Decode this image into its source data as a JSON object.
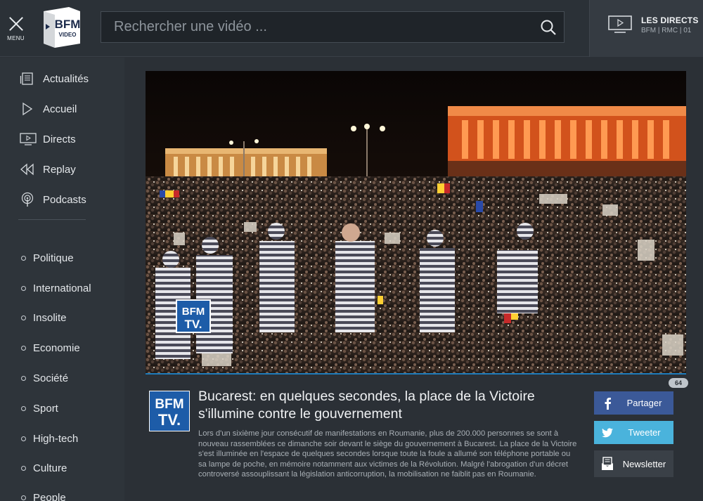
{
  "header": {
    "menu_label": "MENU",
    "logo_text_top": "BFM",
    "logo_text_bottom": "VIDEO",
    "search_placeholder": "Rechercher une vidéo ...",
    "directs_title": "LES DIRECTS",
    "directs_sub": "BFM | RMC | 01"
  },
  "sidebar": {
    "nav": [
      {
        "label": "Actualités",
        "icon": "newspaper-icon"
      },
      {
        "label": "Accueil",
        "icon": "play-outline-icon"
      },
      {
        "label": "Directs",
        "icon": "tv-icon"
      },
      {
        "label": "Replay",
        "icon": "rewind-icon"
      },
      {
        "label": "Podcasts",
        "icon": "podcast-icon"
      }
    ],
    "categories": [
      "Politique",
      "International",
      "Insolite",
      "Economie",
      "Société",
      "Sport",
      "High-tech",
      "Culture",
      "People"
    ]
  },
  "video": {
    "channel_watermark_top": "BFM",
    "channel_watermark_bottom": "TV."
  },
  "article": {
    "views": "64",
    "logo_top": "BFM",
    "logo_bottom": "TV.",
    "title": "Bucarest: en quelques secondes, la place de la Victoire s'illumine contre le gouvernement",
    "description": "Lors d'un sixième jour consécutif de manifestations en Roumanie, plus de 200.000 personnes se sont à nouveau rassemblées ce dimanche soir devant le siège du gouvernement à Bucarest. La place de la Victoire s'est illuminée en l'espace de quelques secondes lorsque toute la foule a allumé son téléphone portable ou sa lampe de poche, en mémoire notamment aux victimes de la Révolution. Malgré l'abrogation d'un décret controversé assouplissant la législation anticorruption, la mobilisation ne faiblit pas en Roumanie."
  },
  "share": {
    "facebook": "Partager",
    "twitter": "Tweeter",
    "newsletter": "Newsletter"
  },
  "colors": {
    "background": "#2b3036",
    "facebook": "#3b5998",
    "twitter": "#4ab3dc",
    "accent_blue": "#1d5ca8"
  }
}
